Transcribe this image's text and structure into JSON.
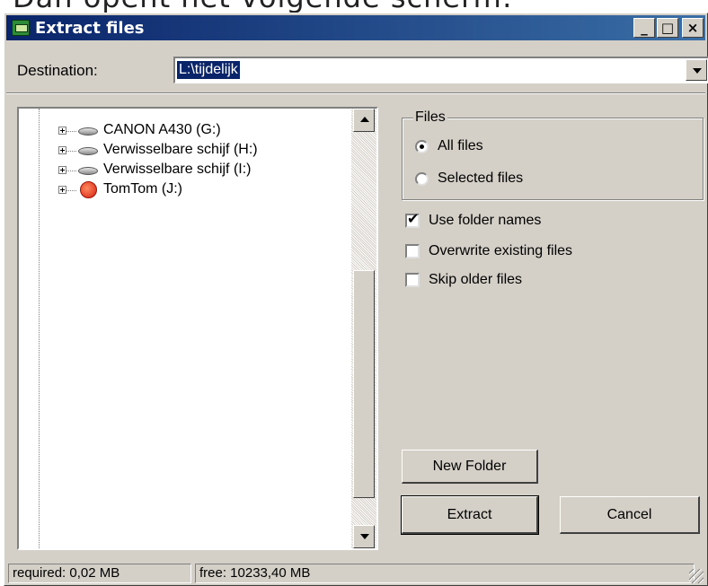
{
  "caption": "Dan opent het volgende scherm:",
  "window": {
    "title": "Extract files",
    "minimize": "_",
    "maximize": "□",
    "close": "×"
  },
  "destination": {
    "label": "Destination:",
    "value": "L:\\tijdelijk"
  },
  "tree": {
    "items": [
      {
        "label": "CANON A430 (G:)",
        "icon": "drive-icon"
      },
      {
        "label": "Verwisselbare schijf (H:)",
        "icon": "drive-icon"
      },
      {
        "label": "Verwisselbare schijf (I:)",
        "icon": "drive-icon"
      },
      {
        "label": "TomTom (J:)",
        "icon": "tomtom-icon"
      }
    ]
  },
  "files_group": {
    "legend": "Files",
    "options": [
      "All files",
      "Selected files"
    ],
    "selected": "All files"
  },
  "checkboxes": [
    {
      "label": "Use folder names",
      "checked": true
    },
    {
      "label": "Overwrite existing files",
      "checked": false
    },
    {
      "label": "Skip older files",
      "checked": false
    }
  ],
  "buttons": {
    "new_folder": "New Folder",
    "extract": "Extract",
    "cancel": "Cancel"
  },
  "status": {
    "required": "required: 0,02 MB",
    "free": "free: 10233,40 MB"
  },
  "checkmark": "✔"
}
